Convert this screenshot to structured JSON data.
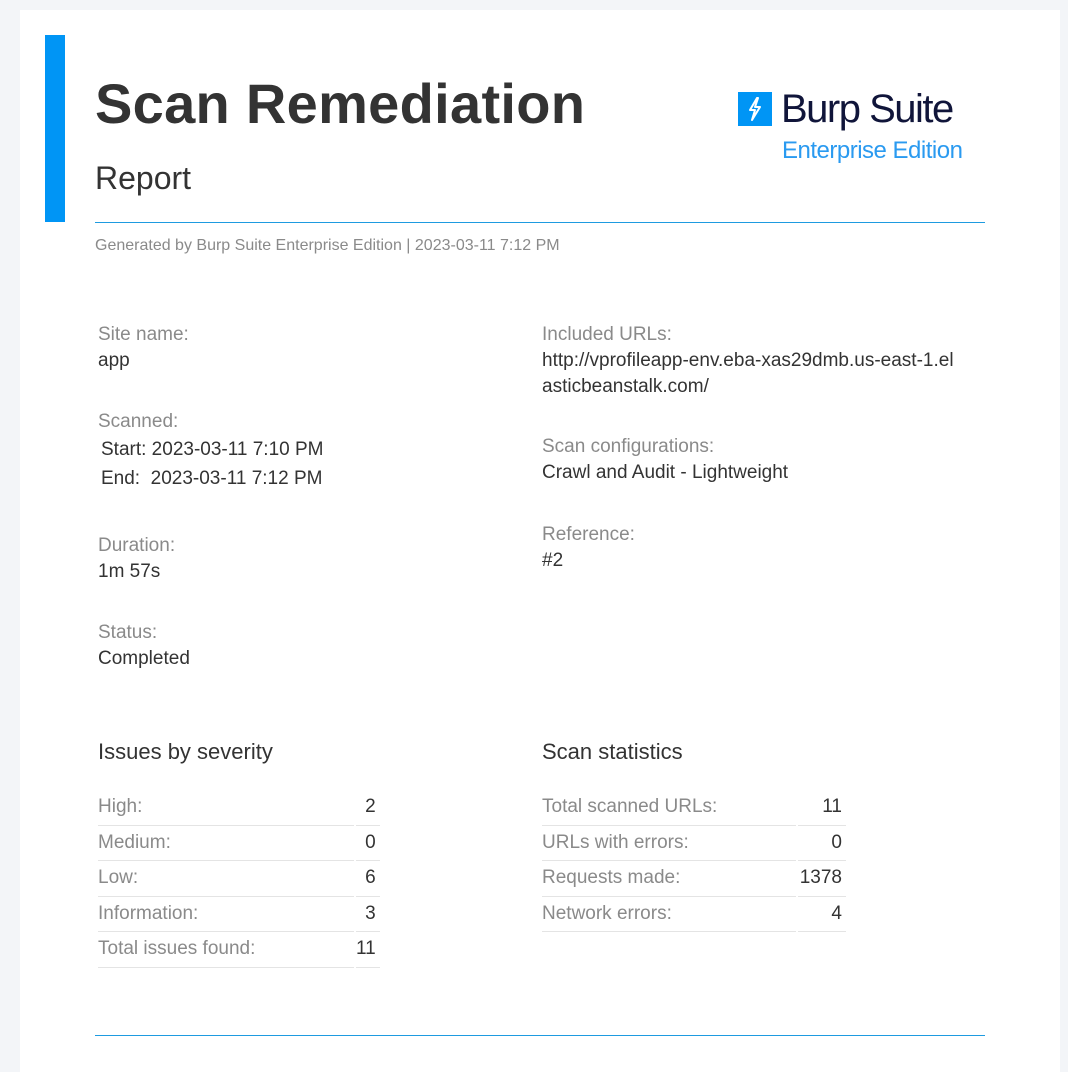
{
  "header": {
    "title": "Scan Remediation",
    "subtitle": "Report",
    "generated": "Generated by Burp Suite Enterprise Edition | 2023-03-11 7:12 PM"
  },
  "logo": {
    "icon": "lightning-bolt-icon",
    "name": "Burp Suite",
    "edition": "Enterprise Edition"
  },
  "colors": {
    "accent": "#0095f5",
    "rule": "#1e9be0",
    "logo_text": "#10153a",
    "label_gray": "#8a8a8a",
    "text": "#333333"
  },
  "details": {
    "site_name_label": "Site name:",
    "site_name": "app",
    "scanned_label": "Scanned:",
    "start_row": "Start: 2023-03-11 7:10 PM",
    "end_row": "End:  2023-03-11 7:12 PM",
    "duration_label": "Duration:",
    "duration": "1m 57s",
    "status_label": "Status:",
    "status": "Completed",
    "included_urls_label": "Included URLs:",
    "included_urls_line1": "http://vprofileapp-env.eba-xas29dmb.us-east-1.el",
    "included_urls_line2": "asticbeanstalk.com/",
    "scan_config_label": "Scan configurations:",
    "scan_config": "Crawl and Audit - Lightweight",
    "reference_label": "Reference:",
    "reference": "#2"
  },
  "severity": {
    "title": "Issues by severity",
    "rows": [
      {
        "label": "High:",
        "value": "2"
      },
      {
        "label": "Medium:",
        "value": "0"
      },
      {
        "label": "Low:",
        "value": "6"
      },
      {
        "label": "Information:",
        "value": "3"
      },
      {
        "label": "Total issues found:",
        "value": "11"
      }
    ]
  },
  "statistics": {
    "title": "Scan statistics",
    "rows": [
      {
        "label": "Total scanned URLs:",
        "value": "11"
      },
      {
        "label": "URLs with errors:",
        "value": "0"
      },
      {
        "label": "Requests made:",
        "value": "1378"
      },
      {
        "label": "Network errors:",
        "value": "4"
      }
    ]
  }
}
